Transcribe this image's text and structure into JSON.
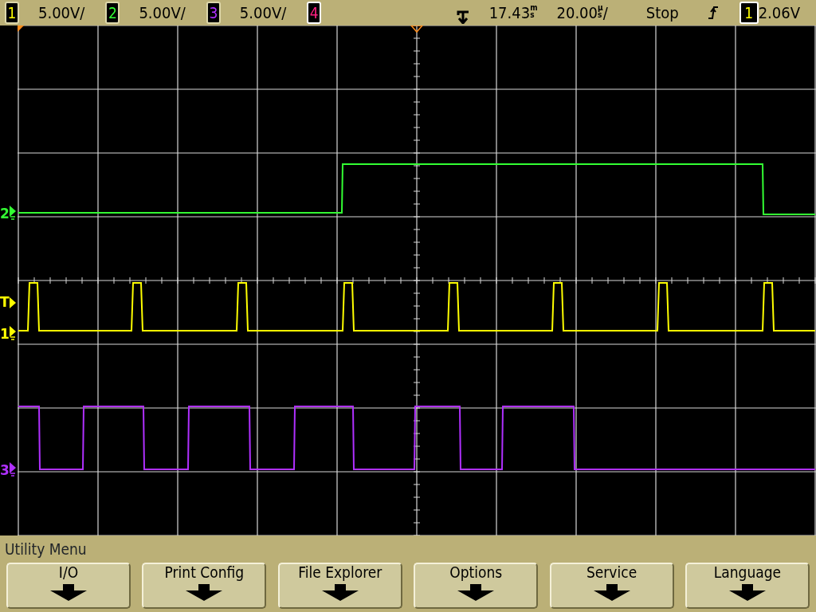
{
  "channels": [
    {
      "number": "1",
      "scale": "5.00V/"
    },
    {
      "number": "2",
      "scale": "5.00V/"
    },
    {
      "number": "3",
      "scale": "5.00V/"
    },
    {
      "number": "4"
    }
  ],
  "delay": {
    "value": "17.43",
    "unit_top": "m",
    "unit_bottom": "s"
  },
  "timebase": {
    "value": "20.00",
    "unit_top": "µ",
    "unit_bottom": "s",
    "suffix": "/"
  },
  "run_state": "Stop",
  "trigger": {
    "source": "1",
    "level": "2.06V"
  },
  "markers": [
    {
      "label": "2",
      "color": "#33ff33",
      "kind": "ground"
    },
    {
      "label": "T",
      "color": "#ffff00",
      "kind": "trigger"
    },
    {
      "label": "1",
      "color": "#ffff00",
      "kind": "ground"
    },
    {
      "label": "3",
      "color": "#b030ff",
      "kind": "ground"
    }
  ],
  "menu": {
    "title": "Utility Menu",
    "softkeys": [
      "I/O",
      "Print Config",
      "File Explorer",
      "Options",
      "Service",
      "Language"
    ]
  }
}
